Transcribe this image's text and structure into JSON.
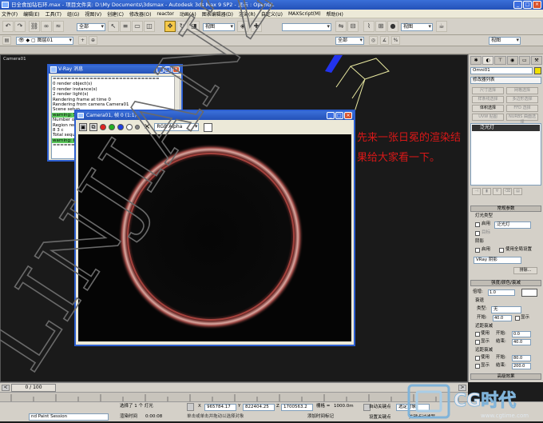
{
  "window": {
    "title": "日全食加钻石环.max   - 项目文件夹: D:\\My Documents\\3dsmax    - Autodesk 3ds Max 9 SP2    - 显示 : OpenGL",
    "min": "_",
    "max": "□",
    "close": "×"
  },
  "menu": [
    "文件(F)",
    "编辑(E)",
    "工具(T)",
    "组(G)",
    "视图(V)",
    "创建(C)",
    "修改器(O)",
    "reactor",
    "动画(A)",
    "图表编辑器(D)",
    "渲染(R)",
    "自定义(U)",
    "MAXScript(M)",
    "帮助(H)"
  ],
  "toolbar": {
    "selection_filter": "全部",
    "ref_coord": "视图",
    "named_sel": "",
    "view_dropdown": "视图",
    "layer": "图层01",
    "filter2": "全部",
    "view2": "视图"
  },
  "viewport": {
    "label": "Camera01"
  },
  "vray_log": {
    "title": "V-Ray 消息",
    "lines": [
      "=============================",
      "0 render object(s)",
      "0 render instance(s)",
      "2 render light(s)",
      "Rendering frame at time 0",
      "Rendering from camera Camera01",
      "Scene setup",
      "warning: So",
      "Number of",
      "Region rend",
      "8 3 c",
      "Total sequen",
      "warning: Di",
      "============"
    ],
    "warn_lines": [
      7,
      12
    ]
  },
  "frame_buffer": {
    "title": "Camera01, 帧 0 (1:1)",
    "channel": "RGB Alpha",
    "clear": "×"
  },
  "annotation": "先来一张日冕的渲染结果给大家看一下。",
  "watermark": "LINJIAN25",
  "command_panel": {
    "object_name": "Omni01",
    "modifier_list": "修改器列表",
    "modifier_buttons": [
      "尺寸选择",
      "网格选择",
      "样条线选择",
      "多边形选择",
      "体积选择",
      "FFD 选择",
      "UVW 贴图",
      "NURBS 曲面选择"
    ],
    "stack_item": "泛光灯",
    "general_params": "常规参数",
    "light_type": "灯光类型",
    "enabled": "启用",
    "light_type_value": "泛光灯",
    "target": "目标",
    "shadows": "阴影",
    "shadows_enabled": "启用",
    "use_global": "使用全局设置",
    "shadow_type": "VRay 阴影",
    "exclude": "排除...",
    "intensity_rollout": "强度/颜色/衰减",
    "multiplier_label": "倍增:",
    "multiplier": "1.0",
    "decay": "衰退",
    "decay_type_label": "类型:",
    "decay_type": "无",
    "start_label": "开始:",
    "start": "40.0",
    "show": "显示",
    "near_atten": "近距衰减",
    "use": "使用",
    "near_start": "0.0",
    "near_end": "40.0",
    "end_label": "结束:",
    "far_atten": "远距衰减",
    "far_start": "80.0",
    "far_end": "200.0",
    "advanced_effects": "高级效果"
  },
  "timebar": {
    "frame": "0 / 100"
  },
  "statusbar": {
    "script_session": "nd Paint Session",
    "selected": "选择了 1 个 灯光",
    "hint": "单击或单击并拖动以选择对象",
    "x_label": "X",
    "x": "965784.17",
    "y_label": "Y",
    "y": "822404.25",
    "z_label": "Z",
    "z": "1700563.2",
    "grid_label": "栅格 =",
    "grid": "1000.0m",
    "auto_key": "自动关键点",
    "set_key": "设置关键点",
    "selected_obj": "选定对象",
    "key_filters": "关键点过滤器",
    "add_time_tag": "添加时间标记",
    "render_time_label": "渲染时间",
    "render_time": "0:00:08"
  },
  "logo": {
    "text": "CG时代",
    "url": "www.cgtime.com"
  },
  "colors": {
    "titlebar": "#2d5fd0",
    "ring": "#b84a44",
    "annotation": "#d81818",
    "active_tool": "#f6c94a"
  }
}
